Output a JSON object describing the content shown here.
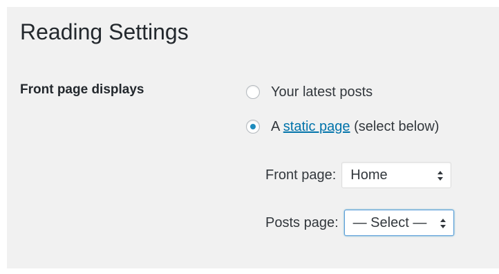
{
  "page": {
    "title": "Reading Settings"
  },
  "front_page_displays": {
    "label": "Front page displays",
    "options": [
      {
        "label": "Your latest posts",
        "checked": false
      },
      {
        "prefix": "A ",
        "link_text": "static page",
        "suffix": " (select below)",
        "checked": true
      }
    ]
  },
  "front_page": {
    "label": "Front page:",
    "selected": "Home"
  },
  "posts_page": {
    "label": "Posts page:",
    "selected": "— Select —"
  },
  "colors": {
    "panel_bg": "#f1f1f1",
    "link": "#0073aa",
    "radio_dot": "#1e8cbe",
    "focus_border": "#5b9dd9"
  },
  "icons": {
    "select_arrows": "updown-arrows-icon"
  }
}
